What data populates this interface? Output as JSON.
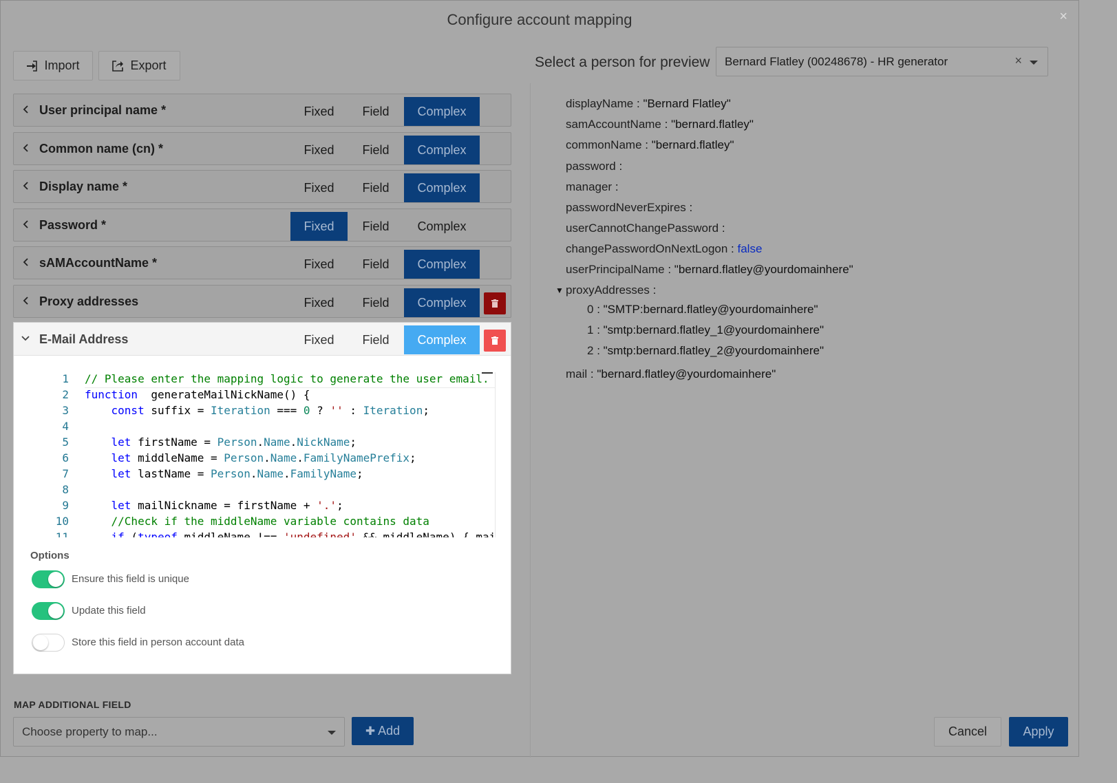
{
  "dialog": {
    "title": "Configure account mapping",
    "close_glyph": "×"
  },
  "toolbar": {
    "import_label": "Import",
    "export_label": "Export"
  },
  "segments": {
    "fixed": "Fixed",
    "field": "Field",
    "complex": "Complex"
  },
  "mappings": [
    {
      "label": "User principal name *",
      "active": "complex",
      "deletable": false
    },
    {
      "label": "Common name (cn) *",
      "active": "complex",
      "deletable": false
    },
    {
      "label": "Display name *",
      "active": "complex",
      "deletable": false
    },
    {
      "label": "Password *",
      "active": "fixed",
      "deletable": false
    },
    {
      "label": "sAMAccountName *",
      "active": "complex",
      "deletable": false
    },
    {
      "label": "Proxy addresses",
      "active": "complex",
      "deletable": true
    }
  ],
  "expanded": {
    "label": "E-Mail Address",
    "active": "complex",
    "line_numbers": [
      "1",
      "2",
      "3",
      "4",
      "5",
      "6",
      "7",
      "8",
      "9",
      "10",
      "11"
    ],
    "code_lines": [
      [
        [
          "c-com",
          "// Please enter the mapping logic to generate the user email."
        ]
      ],
      [
        [
          "c-kw",
          "function"
        ],
        [
          "",
          "  generateMailNickName() {"
        ]
      ],
      [
        [
          "",
          "    "
        ],
        [
          "c-kw",
          "const"
        ],
        [
          "",
          " suffix = "
        ],
        [
          "c-id",
          "Iteration"
        ],
        [
          "",
          " === "
        ],
        [
          "c-num",
          "0"
        ],
        [
          "",
          " ? "
        ],
        [
          "c-str",
          "''"
        ],
        [
          "",
          " : "
        ],
        [
          "c-id",
          "Iteration"
        ],
        [
          "",
          ";"
        ]
      ],
      [
        [
          "",
          ""
        ]
      ],
      [
        [
          "",
          "    "
        ],
        [
          "c-kw",
          "let"
        ],
        [
          "",
          " firstName = "
        ],
        [
          "c-id",
          "Person"
        ],
        [
          "",
          "."
        ],
        [
          "c-id",
          "Name"
        ],
        [
          "",
          "."
        ],
        [
          "c-id",
          "NickName"
        ],
        [
          "",
          ";"
        ]
      ],
      [
        [
          "",
          "    "
        ],
        [
          "c-kw",
          "let"
        ],
        [
          "",
          " middleName = "
        ],
        [
          "c-id",
          "Person"
        ],
        [
          "",
          "."
        ],
        [
          "c-id",
          "Name"
        ],
        [
          "",
          "."
        ],
        [
          "c-id",
          "FamilyNamePrefix"
        ],
        [
          "",
          ";"
        ]
      ],
      [
        [
          "",
          "    "
        ],
        [
          "c-kw",
          "let"
        ],
        [
          "",
          " lastName = "
        ],
        [
          "c-id",
          "Person"
        ],
        [
          "",
          "."
        ],
        [
          "c-id",
          "Name"
        ],
        [
          "",
          "."
        ],
        [
          "c-id",
          "FamilyName"
        ],
        [
          "",
          ";"
        ]
      ],
      [
        [
          "",
          ""
        ]
      ],
      [
        [
          "",
          "    "
        ],
        [
          "c-kw",
          "let"
        ],
        [
          "",
          " mailNickname = firstName + "
        ],
        [
          "c-str",
          "'.'"
        ],
        [
          "",
          ";"
        ]
      ],
      [
        [
          "",
          "    "
        ],
        [
          "c-com",
          "//Check if the middleName variable contains data"
        ]
      ],
      [
        [
          "",
          "    "
        ],
        [
          "c-kw",
          "if"
        ],
        [
          "",
          " ("
        ],
        [
          "c-kw",
          "typeof"
        ],
        [
          "",
          " middleName !== "
        ],
        [
          "c-str",
          "'undefined'"
        ],
        [
          "",
          " && middleName) { mailN"
        ]
      ]
    ],
    "options_title": "Options",
    "options": [
      {
        "label": "Ensure this field is unique",
        "on": true
      },
      {
        "label": "Update this field",
        "on": true
      },
      {
        "label": "Store this field in person account data",
        "on": false
      }
    ]
  },
  "map_additional": {
    "title": "MAP ADDITIONAL FIELD",
    "placeholder": "Choose property to map...",
    "add_label": "Add",
    "add_glyph": "✚"
  },
  "preview": {
    "label": "Select a person for preview",
    "selected_person": "Bernard Flatley (00248678) - HR generator",
    "clear_glyph": "×",
    "fields": [
      {
        "key": "displayName",
        "value": "\"Bernard Flatley\""
      },
      {
        "key": "samAccountName",
        "value": "\"bernard.flatley\""
      },
      {
        "key": "commonName",
        "value": "\"bernard.flatley\""
      },
      {
        "key": "password",
        "value": ""
      },
      {
        "key": "manager",
        "value": ""
      },
      {
        "key": "passwordNeverExpires",
        "value": ""
      },
      {
        "key": "userCannotChangePassword",
        "value": ""
      },
      {
        "key": "changePasswordOnNextLogon",
        "value": "false",
        "bool": true
      },
      {
        "key": "userPrincipalName",
        "value": "\"bernard.flatley@yourdomainhere\""
      },
      {
        "key": "proxyAddresses",
        "value": "",
        "expandable": true,
        "expander_glyph": "▼"
      },
      {
        "key": "0",
        "value": "\"SMTP:bernard.flatley@yourdomainhere\"",
        "child": true
      },
      {
        "key": "1",
        "value": "\"smtp:bernard.flatley_1@yourdomainhere\"",
        "child": true
      },
      {
        "key": "2",
        "value": "\"smtp:bernard.flatley_2@yourdomainhere\"",
        "child": true
      },
      {
        "key": "mail",
        "value": "\"bernard.flatley@yourdomainhere\""
      }
    ]
  },
  "footer": {
    "cancel_label": "Cancel",
    "apply_label": "Apply"
  }
}
